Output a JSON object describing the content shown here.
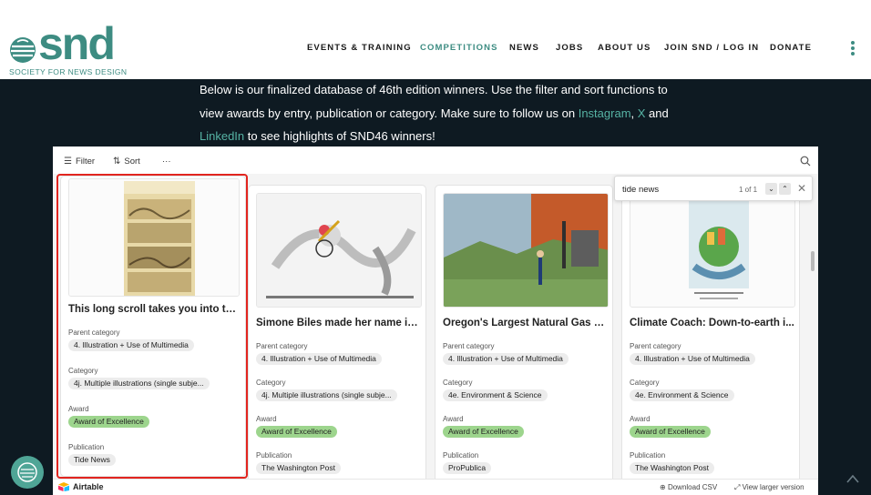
{
  "header": {
    "logo": {
      "wordmark": "snd",
      "tagline": "SOCIETY FOR NEWS DESIGN"
    },
    "nav": [
      {
        "label": "EVENTS & TRAINING",
        "active": false
      },
      {
        "label": "COMPETITIONS",
        "active": true
      },
      {
        "label": "NEWS",
        "active": false
      },
      {
        "label": "JOBS",
        "active": false
      },
      {
        "label": "ABOUT US",
        "active": false
      },
      {
        "label": "JOIN SND / LOG IN",
        "active": false
      },
      {
        "label": "DONATE",
        "active": false
      }
    ],
    "more_icon": "kebab-menu-icon"
  },
  "intro": {
    "line1": "Below is our finalized database of 46th edition winners. Use the filter and sort functions to",
    "line2_pre": "view awards by entry, publication or category. Make sure to follow us on ",
    "link_instagram": "Instagram",
    "sep": ", ",
    "link_x": "X",
    "line2_post": " and",
    "link_linkedin": "LinkedIn",
    "line3_post": " to see highlights of SND46 winners!"
  },
  "toolbar": {
    "filter_label": "Filter",
    "sort_label": "Sort",
    "more_label": "···",
    "search_icon": "search-icon"
  },
  "find": {
    "query": "tide news",
    "count": "1 of 1",
    "prev_icon": "chevron-down-icon",
    "next_icon": "chevron-up-icon",
    "close_icon": "close-icon"
  },
  "field_labels": {
    "parent_category": "Parent category",
    "category": "Category",
    "award": "Award",
    "publication": "Publication"
  },
  "cards": [
    {
      "title": "This long scroll takes you into th...",
      "parent_category": "4. Illustration + Use of Multimedia",
      "category": "4j. Multiple illustrations (single subje...",
      "award": "Award of Excellence",
      "publication": "Tide News",
      "highlighted": true
    },
    {
      "title": "Simone Biles made her name in ...",
      "parent_category": "4. Illustration + Use of Multimedia",
      "category": "4j. Multiple illustrations (single subje...",
      "award": "Award of Excellence",
      "publication": "The Washington Post",
      "highlighted": false
    },
    {
      "title": "Oregon's Largest Natural Gas C...",
      "parent_category": "4. Illustration + Use of Multimedia",
      "category": "4e. Environment & Science",
      "award": "Award of Excellence",
      "publication": "ProPublica",
      "highlighted": false
    },
    {
      "title": "Climate Coach: Down-to-earth i...",
      "parent_category": "4. Illustration + Use of Multimedia",
      "category": "4e. Environment & Science",
      "award": "Award of Excellence",
      "publication": "The Washington Post",
      "highlighted": false
    }
  ],
  "footer": {
    "brand": "Airtable",
    "download_csv": "Download CSV",
    "view_larger": "View larger version"
  },
  "colors": {
    "brand_teal": "#3d8c82",
    "page_dark": "#0e1a22",
    "award_green": "#9dd58d",
    "highlight_red": "#e2251f"
  }
}
